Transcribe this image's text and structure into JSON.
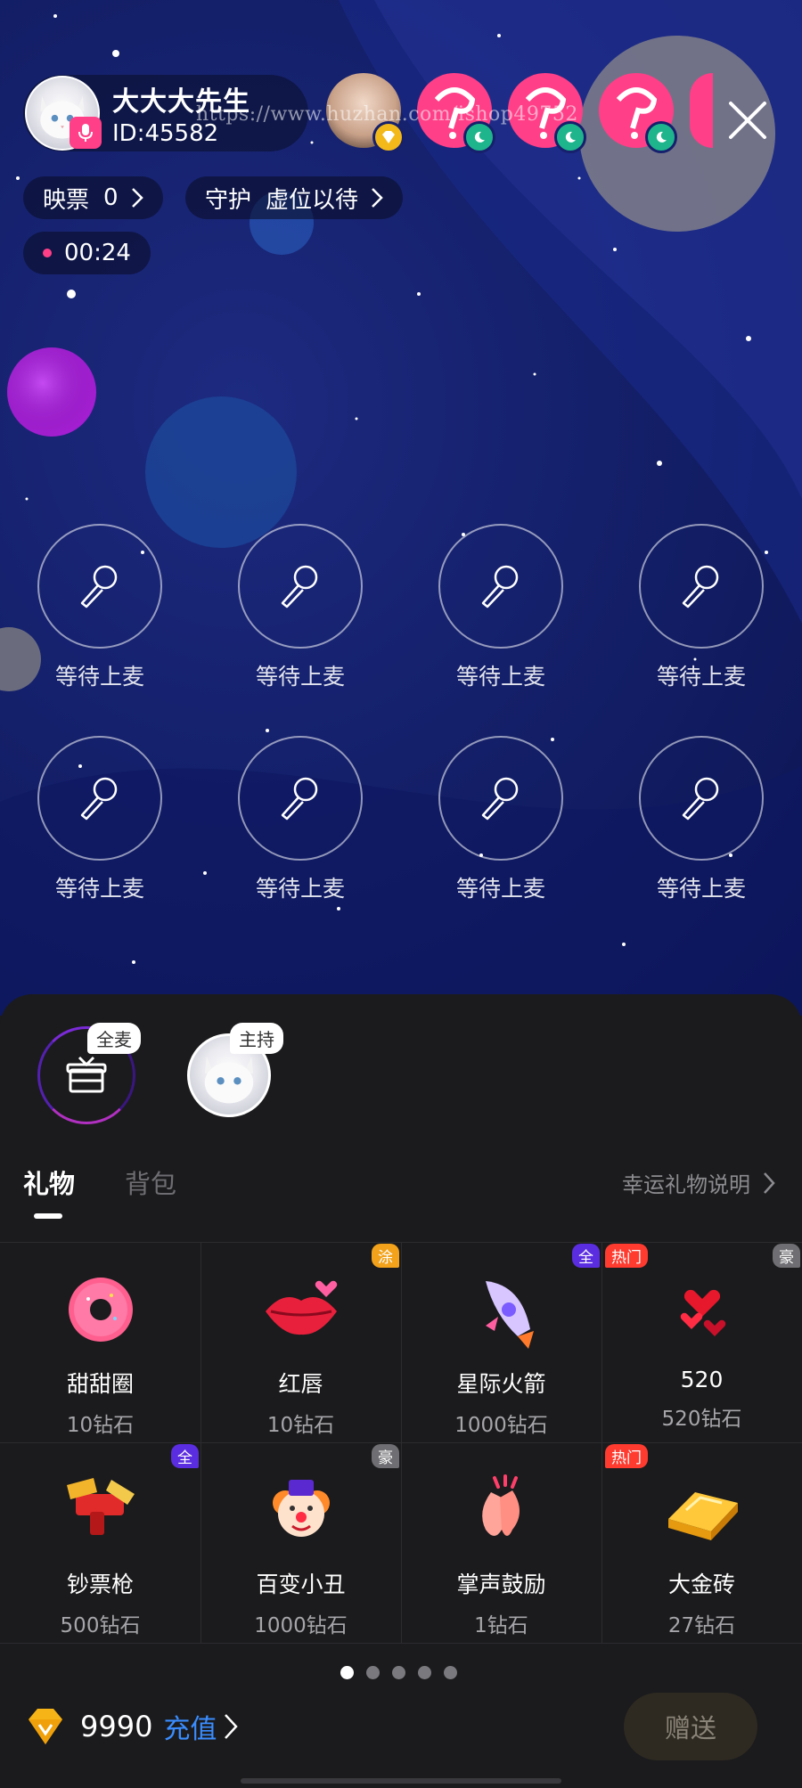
{
  "header": {
    "host_name": "大大大先生",
    "host_id": "ID:45582",
    "watermark": "https://www.huzhan.com/ishop49752",
    "close_icon": "close-icon"
  },
  "stats": {
    "votes_label": "映票",
    "votes_value": "0",
    "guard_label": "守护",
    "guard_value": "虚位以待",
    "timer": "00:24"
  },
  "seats": [
    {
      "label": "等待上麦"
    },
    {
      "label": "等待上麦"
    },
    {
      "label": "等待上麦"
    },
    {
      "label": "等待上麦"
    },
    {
      "label": "等待上麦"
    },
    {
      "label": "等待上麦"
    },
    {
      "label": "等待上麦"
    },
    {
      "label": "等待上麦"
    }
  ],
  "recipients": {
    "all_tag": "全麦",
    "host_tag": "主持"
  },
  "tabs": {
    "gift": "礼物",
    "bag": "背包",
    "lucky_info": "幸运礼物说明"
  },
  "gifts": [
    {
      "name": "甜甜圈",
      "price": "10钻石",
      "tag": "",
      "icon": "donut-icon"
    },
    {
      "name": "红唇",
      "price": "10钻石",
      "tag": "涂",
      "icon": "lips-icon"
    },
    {
      "name": "星际火箭",
      "price": "1000钻石",
      "tag": "全",
      "icon": "rocket-icon"
    },
    {
      "name": "520",
      "price": "520钻石",
      "tag": "热门",
      "tag2": "豪",
      "icon": "hearts-icon"
    },
    {
      "name": "钞票枪",
      "price": "500钻石",
      "tag": "全",
      "icon": "money-gun-icon"
    },
    {
      "name": "百变小丑",
      "price": "1000钻石",
      "tag": "豪",
      "icon": "clown-icon"
    },
    {
      "name": "掌声鼓励",
      "price": "1钻石",
      "tag": "",
      "icon": "clap-icon"
    },
    {
      "name": "大金砖",
      "price": "27钻石",
      "tag": "热门",
      "icon": "gold-bar-icon"
    }
  ],
  "pagination": {
    "pages": 5,
    "current": 1
  },
  "footer": {
    "balance": "9990",
    "recharge": "充值",
    "send": "赠送"
  },
  "colors": {
    "accent_pink": "#ff3f87",
    "link_blue": "#3a8dff",
    "tag_purple": "#5b2de0",
    "tag_red": "#ff3b30",
    "tag_orange": "#f2a21b",
    "tag_gray": "#6f6f73"
  }
}
